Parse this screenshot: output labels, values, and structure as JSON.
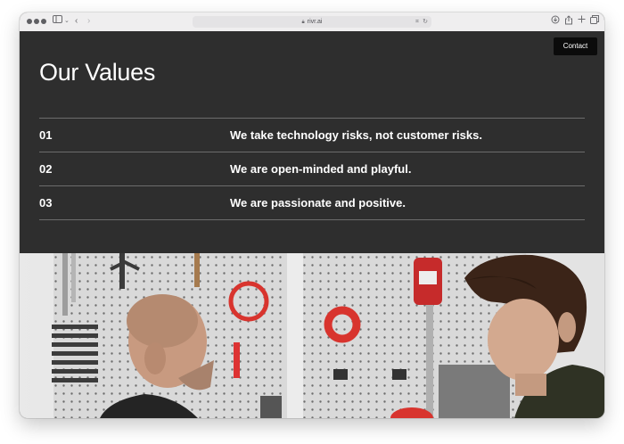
{
  "browser": {
    "url": "rivr.ai"
  },
  "header": {
    "contact_label": "Contact"
  },
  "main": {
    "title": "Our Values",
    "values": [
      {
        "number": "01",
        "text": "We take technology risks, not customer risks."
      },
      {
        "number": "02",
        "text": "We are open-minded and playful."
      },
      {
        "number": "03",
        "text": "We are passionate and positive."
      }
    ]
  },
  "icons": [
    "sidebar-icon",
    "chevron-left-icon",
    "chevron-right-icon",
    "lock-icon",
    "translate-icon",
    "reload-icon",
    "download-icon",
    "share-icon",
    "new-tab-icon",
    "tabs-overview-icon"
  ],
  "colors": {
    "page_background": "#2e2e2e",
    "contact_button": "#0b0b0b",
    "text": "#ffffff",
    "divider": "#6c6c6c"
  }
}
